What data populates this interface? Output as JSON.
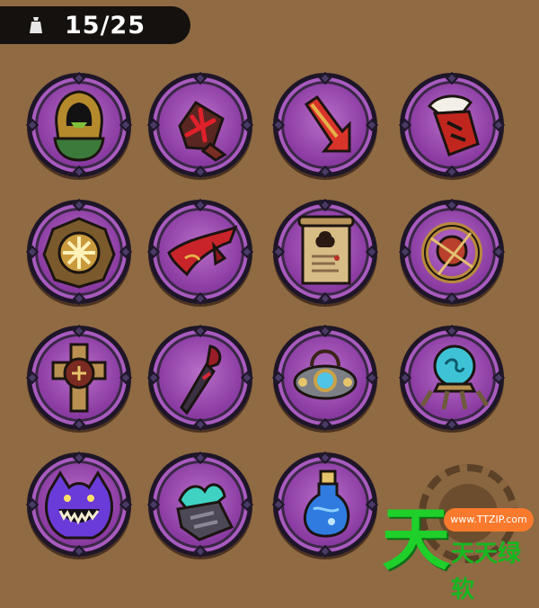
{
  "inventory": {
    "capacity_text": "15/25",
    "capacity_icon": "weight-bag-icon",
    "items": [
      {
        "name": "hooded-figure-relic-icon",
        "accent": "#3b7a3a"
      },
      {
        "name": "red-trident-glove-icon",
        "accent": "#c8202a"
      },
      {
        "name": "red-arrow-relic-icon",
        "accent": "#d8342a"
      },
      {
        "name": "feathered-fist-relic-icon",
        "accent": "#c0261e"
      },
      {
        "name": "golden-star-shield-icon",
        "accent": "#e6c46a"
      },
      {
        "name": "red-scarf-relic-icon",
        "accent": "#c9242a"
      },
      {
        "name": "ancient-scroll-map-icon",
        "accent": "#d8bc86"
      },
      {
        "name": "red-orb-ring-icon",
        "accent": "#b8402c"
      },
      {
        "name": "bronze-cross-sigil-icon",
        "accent": "#b99050"
      },
      {
        "name": "dark-crimson-dagger-icon",
        "accent": "#9a1d28"
      },
      {
        "name": "jeweled-amulet-icon",
        "accent": "#4fc4e6"
      },
      {
        "name": "spirit-orb-lantern-icon",
        "accent": "#3ec2d6"
      },
      {
        "name": "grinning-purple-ghost-icon",
        "accent": "#6a3bd8"
      },
      {
        "name": "teal-flame-gauntlet-icon",
        "accent": "#3fd2c2"
      },
      {
        "name": "blue-potion-bottle-icon",
        "accent": "#2f7be0"
      }
    ],
    "empty_slots": 1
  },
  "watermark": {
    "glyph": "天",
    "url": "www.TTZIP.com",
    "label": "天天绿软"
  }
}
